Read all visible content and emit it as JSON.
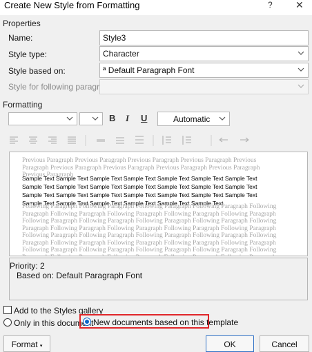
{
  "window": {
    "title": "Create New Style from Formatting",
    "help": "?",
    "close": "✕"
  },
  "properties": {
    "heading": "Properties",
    "name_label": "Name:",
    "name_value": "Style3",
    "style_type_label": "Style type:",
    "style_type_value": "Character",
    "based_on_label": "Style based on:",
    "based_on_value": "ª Default Paragraph Font",
    "following_label": "Style for following paragraph:",
    "following_value": ""
  },
  "formatting": {
    "heading": "Formatting",
    "font_value": "",
    "size_value": "",
    "bold": "B",
    "italic": "I",
    "underline": "U",
    "color_value": "Automatic"
  },
  "preview": {
    "previous_paragraph": "Previous Paragraph Previous Paragraph Previous Paragraph Previous Paragraph Previous Paragraph Previous Paragraph Previous Paragraph Previous Paragraph Previous Paragraph Previous Paragraph",
    "sample_text": "Sample Text Sample Text Sample Text Sample Text Sample Text Sample Text Sample Text Sample Text Sample Text Sample Text Sample Text Sample Text Sample Text Sample Text Sample Text Sample Text Sample Text Sample Text Sample Text Sample Text Sample Text Sample Text Sample Text Sample Text Sample Text Sample Text Sample Text",
    "following_paragraph": "Following Paragraph Following Paragraph Following Paragraph Following Paragraph Following Paragraph Following Paragraph Following Paragraph Following Paragraph Following Paragraph Following Paragraph Following Paragraph Following Paragraph Following Paragraph Following Paragraph Following Paragraph Following Paragraph Following Paragraph Following Paragraph Following Paragraph Following Paragraph Following Paragraph Following Paragraph Following Paragraph Following Paragraph Following Paragraph Following Paragraph Following Paragraph Following Paragraph Following Paragraph Following Paragraph Following Paragraph Following Paragraph Following Paragraph Following Paragraph Following Paragraph Following Paragraph Following Paragraph Following Paragraph Following Paragraph Following Paragraph"
  },
  "description": {
    "priority": "Priority: 2",
    "based_on": "Based on: Default Paragraph Font"
  },
  "options": {
    "add_to_gallery": "Add to the Styles gallery",
    "only_this_document": "Only in this document",
    "new_documents": "New documents based on this template",
    "selected_scope": "New documents based on this template"
  },
  "buttons": {
    "format": "Format",
    "ok": "OK",
    "cancel": "Cancel"
  },
  "colors": {
    "accent": "#0a64c8",
    "highlight": "#e0262a"
  }
}
